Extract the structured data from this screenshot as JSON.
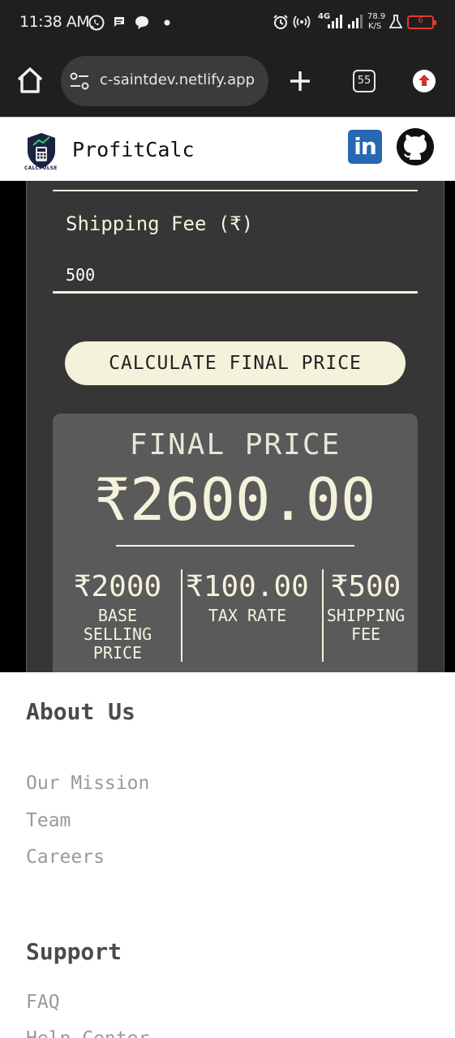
{
  "status_bar": {
    "time": "11:38 AM",
    "network_type": "4G",
    "speed_value": "78.9",
    "speed_unit": "K/S",
    "battery_level": "6"
  },
  "browser": {
    "url": "c-saintdev.netlify.app",
    "tab_count": "55"
  },
  "site": {
    "logo_text": "CALCPULSE",
    "brand": "ProfitCalc",
    "linkedin_label": "in"
  },
  "calculator": {
    "shipping_label": "Shipping Fee (₹)",
    "shipping_value": "500",
    "button_label": "CALCULATE FINAL PRICE",
    "result": {
      "title": "FINAL PRICE",
      "value": "₹2600.00",
      "stats": [
        {
          "value": "₹2000",
          "label": "BASE SELLING PRICE"
        },
        {
          "value": "₹100.00",
          "label": "TAX RATE"
        },
        {
          "value": "₹500",
          "label": "SHIPPING FEE"
        }
      ]
    }
  },
  "footer": {
    "about": {
      "heading": "About Us",
      "links": [
        "Our Mission",
        "Team",
        "Careers"
      ]
    },
    "support": {
      "heading": "Support",
      "links": [
        "FAQ",
        "Help Center"
      ]
    }
  },
  "colors": {
    "accent": "#f5f2dc",
    "card_bg": "#363636",
    "result_bg": "#5a5a5a",
    "linkedin": "#2867b2",
    "battery_low": "#e53935"
  },
  "icons": [
    "whatsapp-icon",
    "message-icon",
    "chat-icon",
    "alarm-icon",
    "hotspot-icon",
    "signal-icon",
    "flask-icon",
    "battery-icon",
    "home-icon",
    "tune-icon",
    "plus-icon",
    "tabs-icon",
    "update-icon",
    "calcpulse-logo",
    "linkedin-icon",
    "github-icon"
  ]
}
